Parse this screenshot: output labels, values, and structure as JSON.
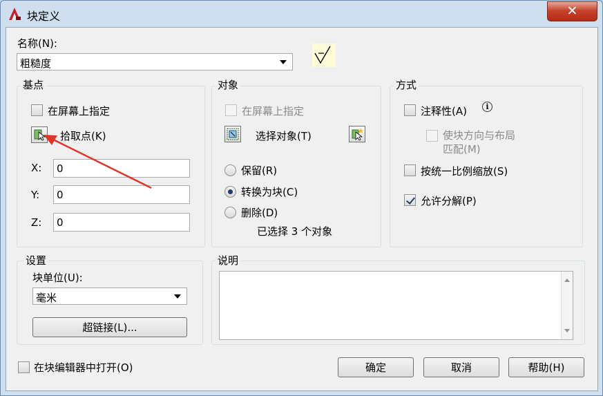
{
  "window": {
    "title": "块定义"
  },
  "name": {
    "label": "名称(N):",
    "value": "粗糙度"
  },
  "basepoint": {
    "title": "基点",
    "specify_label": "在屏幕上指定",
    "pick_label": "拾取点(K)",
    "x_label": "X:",
    "x_value": "0",
    "y_label": "Y:",
    "y_value": "0",
    "z_label": "Z:",
    "z_value": "0"
  },
  "objects": {
    "title": "对象",
    "specify_label": "在屏幕上指定",
    "select_label": "选择对象(T)",
    "retain_label": "保留(R)",
    "convert_label": "转换为块(C)",
    "delete_label": "删除(D)",
    "status": "已选择 3 个对象"
  },
  "behavior": {
    "title": "方式",
    "annotative_label": "注释性(A)",
    "match_orient_label_1": "使块方向与布局",
    "match_orient_label_2": "匹配(M)",
    "scale_uniform_label": "按统一比例缩放(S)",
    "allow_explode_label": "允许分解(P)"
  },
  "settings": {
    "title": "设置",
    "unit_label": "块单位(U):",
    "unit_value": "毫米",
    "hyperlink_label": "超链接(L)..."
  },
  "description": {
    "title": "说明"
  },
  "footer": {
    "open_editor_label": "在块编辑器中打开(O)",
    "ok_label": "确定",
    "cancel_label": "取消",
    "help_label": "帮助(H)"
  },
  "colors": {
    "accent_arrow": "#e0342a",
    "close_button": "#c8442d"
  }
}
